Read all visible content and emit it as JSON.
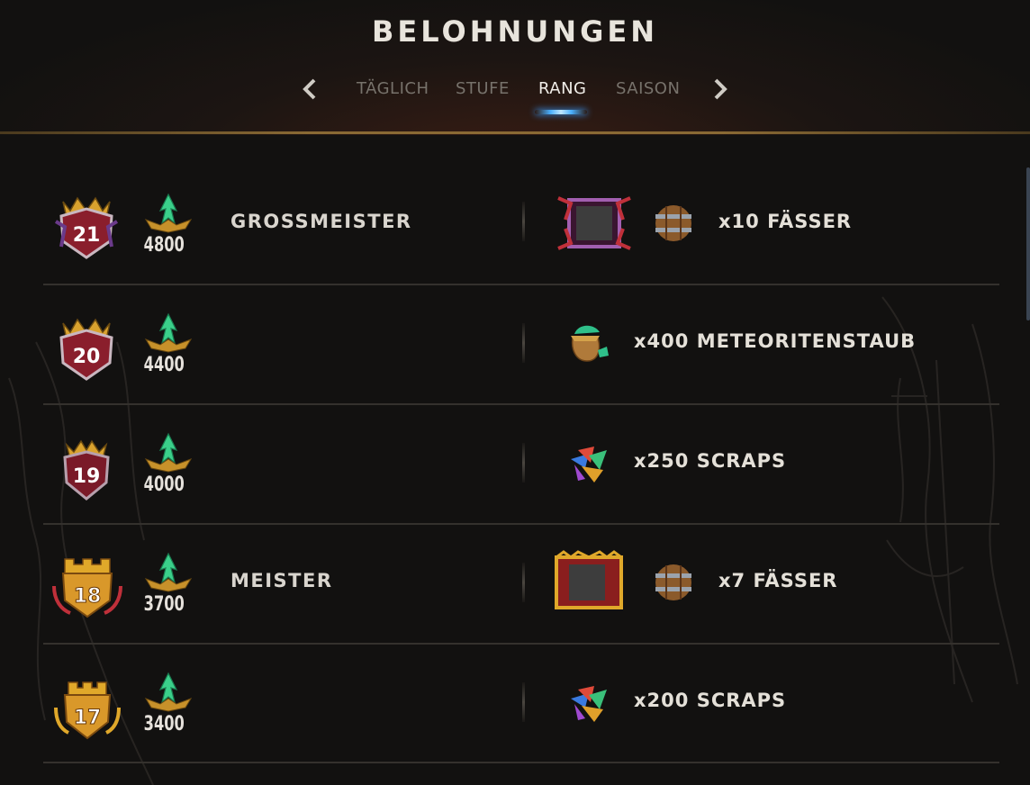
{
  "header": {
    "title": "BELOHNUNGEN",
    "tabs": [
      {
        "label": "TÄGLICH",
        "active": false
      },
      {
        "label": "STUFE",
        "active": false
      },
      {
        "label": "RANG",
        "active": true
      },
      {
        "label": "SAISON",
        "active": false
      }
    ],
    "prev_icon": "chevron-left-icon",
    "next_icon": "chevron-right-icon"
  },
  "rows": [
    {
      "rank": "21",
      "points": "4800",
      "title": "GROSSMEISTER",
      "badge_style": "red",
      "reward_label": "x10 FÄSSER",
      "reward_icons": [
        "grandmaster-frame-icon",
        "barrel-icon"
      ]
    },
    {
      "rank": "20",
      "points": "4400",
      "title": "",
      "badge_style": "red",
      "reward_label": "x400 METEORITENSTAUB",
      "reward_icons": [
        "meteorite-dust-icon"
      ]
    },
    {
      "rank": "19",
      "points": "4000",
      "title": "",
      "badge_style": "red",
      "reward_label": "x250 SCRAPS",
      "reward_icons": [
        "scraps-icon"
      ]
    },
    {
      "rank": "18",
      "points": "3700",
      "title": "MEISTER",
      "badge_style": "gold",
      "reward_label": "x7 FÄSSER",
      "reward_icons": [
        "master-frame-icon",
        "barrel-icon"
      ]
    },
    {
      "rank": "17",
      "points": "3400",
      "title": "",
      "badge_style": "gold",
      "reward_label": "x200 SCRAPS",
      "reward_icons": [
        "scraps-icon"
      ]
    }
  ],
  "colors": {
    "accent_blue": "#4ab0ff",
    "gold": "#e0a82a",
    "red_badge": "#8a1e2c",
    "arrow_green": "#3ad08a"
  }
}
